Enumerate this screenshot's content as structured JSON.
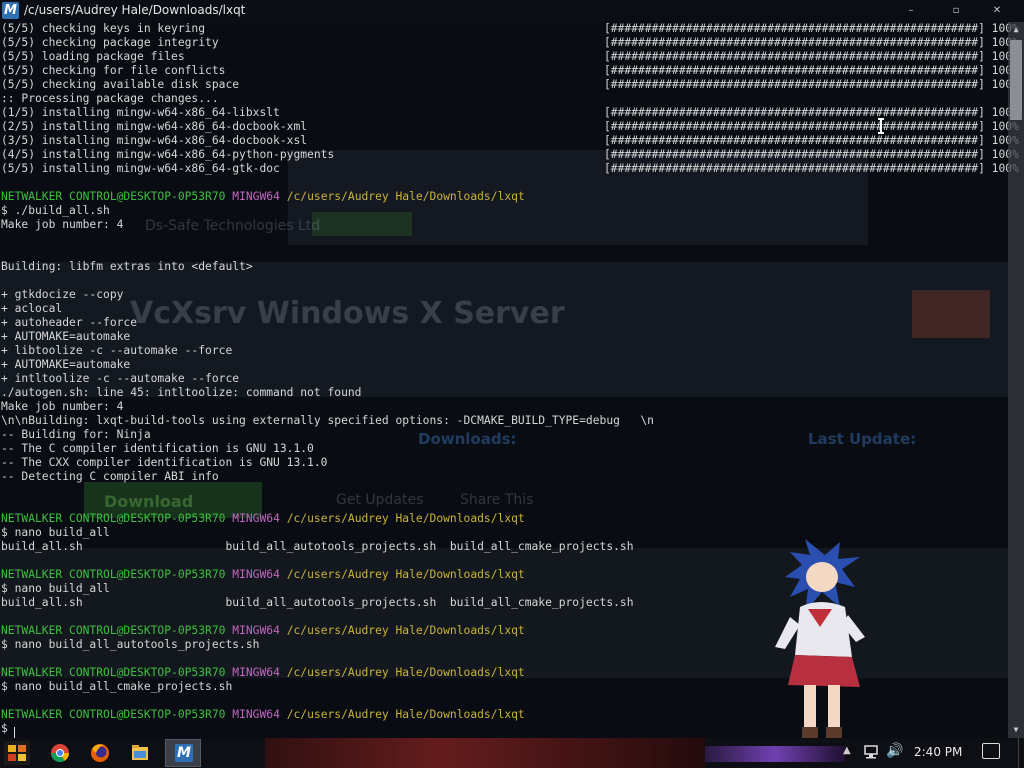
{
  "window": {
    "title": "/c/users/Audrey Hale/Downloads/lxqt",
    "app_icon_letter": "M",
    "minimize_label": "–",
    "maximize_label": "▫",
    "close_label": "✕"
  },
  "terminal": {
    "progress_lines": [
      {
        "text": "(5/5) checking keys in keyring",
        "bar": "[######################################################] 100%"
      },
      {
        "text": "(5/5) checking package integrity",
        "bar": "[######################################################] 100%"
      },
      {
        "text": "(5/5) loading package files",
        "bar": "[######################################################] 100%"
      },
      {
        "text": "(5/5) checking for file conflicts",
        "bar": "[######################################################] 100%"
      },
      {
        "text": "(5/5) checking available disk space",
        "bar": "[######################################################] 100%"
      },
      {
        "text": ":: Processing package changes...",
        "bar": ""
      },
      {
        "text": "(1/5) installing mingw-w64-x86_64-libxslt",
        "bar": "[######################################################] 100%"
      },
      {
        "text": "(2/5) installing mingw-w64-x86_64-docbook-xml",
        "bar": "[######################################################] 100%"
      },
      {
        "text": "(3/5) installing mingw-w64-x86_64-docbook-xsl",
        "bar": "[######################################################] 100%"
      },
      {
        "text": "(4/5) installing mingw-w64-x86_64-python-pygments",
        "bar": "[######################################################] 100%"
      },
      {
        "text": "(5/5) installing mingw-w64-x86_64-gtk-doc",
        "bar": "[######################################################] 100%"
      }
    ],
    "prompt": {
      "user": "NETWALKER CONTROL@DESKTOP-0P53R70",
      "system": "MINGW64",
      "path": "/c/users/Audrey Hale/Downloads/lxqt"
    },
    "block1": [
      "$ ./build_all.sh",
      "Make job number: 4",
      "",
      "",
      "Building: libfm extras into <default>",
      "",
      "+ gtkdocize --copy",
      "+ aclocal",
      "+ autoheader --force",
      "+ AUTOMAKE=automake",
      "+ libtoolize -c --automake --force",
      "+ AUTOMAKE=automake",
      "+ intltoolize -c --automake --force",
      "./autogen.sh: line 45: intltoolize: command not found",
      "Make job number: 4",
      "\\n\\nBuilding: lxqt-build-tools using externally specified options: -DCMAKE_BUILD_TYPE=debug   \\n",
      "-- Building for: Ninja",
      "-- The C compiler identification is GNU 13.1.0",
      "-- The CXX compiler identification is GNU 13.1.0",
      "-- Detecting C compiler ABI info"
    ],
    "block2": [
      "$ nano build_all",
      "build_all.sh                     build_all_autotools_projects.sh  build_all_cmake_projects.sh"
    ],
    "block3": [
      "$ nano build_all",
      "build_all.sh                     build_all_autotools_projects.sh  build_all_cmake_projects.sh"
    ],
    "block4": [
      "$ nano build_all_autotools_projects.sh"
    ],
    "block5": [
      "$ nano build_all_cmake_projects.sh"
    ],
    "final_prompt": "$ "
  },
  "background_page": {
    "company": "Ds-Safe Technologies Ltd",
    "heading": "VcXsrv Windows X Server",
    "downloads_label": "Downloads:",
    "last_update_label": "Last Update:",
    "download_button": "Download",
    "get_updates_button": "Get Updates",
    "share_this_button": "Share This"
  },
  "taskbar": {
    "clock": "2:40 PM",
    "tray_up_arrow": "▲",
    "volume_glyph": "🔊",
    "icons": [
      "start-icon",
      "chrome-icon",
      "firefox-icon",
      "file-explorer-icon",
      "mintty-icon"
    ]
  },
  "colors": {
    "prompt_user": "#3fbf3f",
    "prompt_system": "#c266c2",
    "prompt_path": "#c9b23b",
    "terminal_text": "#d6d6d6",
    "titlebar": "#0a0e14",
    "taskbar": "#0d0f14"
  }
}
